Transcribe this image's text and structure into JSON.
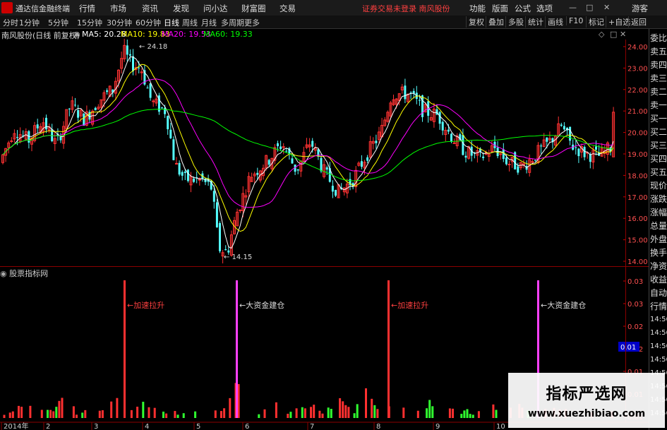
{
  "menubar": {
    "app_title": "通达信金融终端",
    "menus": [
      "行情",
      "市场",
      "资讯",
      "发现",
      "问小达",
      "财富圈",
      "交易"
    ],
    "notice": "证券交易未登录  南风股份",
    "right_menus": [
      "功能",
      "版面",
      "公式",
      "选项"
    ],
    "guest": "游客",
    "window_buttons": [
      "—",
      "□",
      "✕"
    ]
  },
  "periodbar": {
    "periods": [
      "分时",
      "1分钟",
      "5分钟",
      "15分钟",
      "30分钟",
      "60分钟",
      "日线",
      "周线",
      "月线",
      "多周期",
      "更多"
    ],
    "active": "日线",
    "tools": [
      "复权",
      "叠加",
      "多股",
      "统计",
      "画线",
      "F10",
      "标记",
      "+自选",
      "返回"
    ]
  },
  "main_chart": {
    "stock_label": "南风股份(日线 前复权)",
    "ma_labels": [
      {
        "text": "MA5: 20.28",
        "color": "#ffffff"
      },
      {
        "text": "MA10: 19.83",
        "color": "#ffff00"
      },
      {
        "text": "MA20: 19.53",
        "color": "#ff00ff"
      },
      {
        "text": "MA60: 19.33",
        "color": "#00ff00"
      }
    ],
    "price_ticks": [
      "24.00",
      "23.00",
      "22.00",
      "21.00",
      "20.00",
      "19.00",
      "18.00",
      "17.00",
      "16.00",
      "15.00",
      "14.00"
    ],
    "high_marker": "24.18",
    "low_marker": "14.15"
  },
  "indicator_panel": {
    "title": "股票指标网",
    "annotations": [
      "加速拉升",
      "大资金建仓",
      "加速拉升",
      "大资金建仓"
    ],
    "y_ticks": [
      "0.03",
      "0.03",
      "0.02",
      "0.02",
      "0.01",
      "0.01",
      "0.01"
    ],
    "highlight_value": "0.01"
  },
  "x_axis": {
    "labels": [
      "2014年",
      "2",
      "3",
      "4",
      "5",
      "6",
      "7",
      "8",
      "9",
      "10"
    ]
  },
  "side_panel": {
    "labels": [
      "委比",
      "卖五",
      "卖四",
      "卖三",
      "卖二",
      "卖一",
      "买一",
      "买二",
      "买三",
      "买四",
      "买五",
      "现价",
      "涨跌",
      "涨幅",
      "总量",
      "外盘",
      "换手",
      "净资",
      "收益",
      "自动",
      "行情",
      "14:56",
      "14:56",
      "14:56",
      "14:56",
      "14:56",
      "14:56",
      "14:56",
      "14:56"
    ]
  },
  "watermark": {
    "line1": "指标严选网",
    "line2": "www.xuezhibiao.com"
  },
  "colors": {
    "up": "#ff3232",
    "down": "#54ffff",
    "ma5": "#ffffff",
    "ma10": "#ffff00",
    "ma20": "#ff00ff",
    "ma60": "#00ff00",
    "volume_up": "#ff3030",
    "volume_down": "#30ff30",
    "signal_pink": "#ff40ff"
  }
}
